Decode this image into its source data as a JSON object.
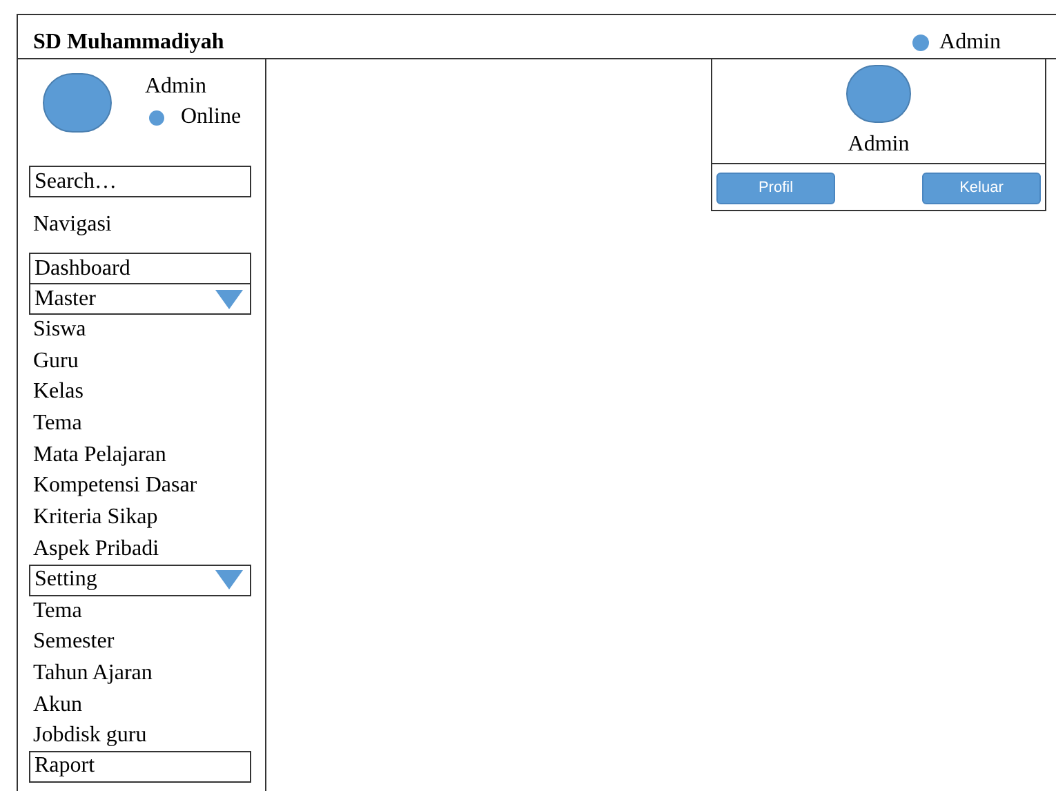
{
  "header": {
    "title": "SD Muhammadiyah",
    "user": "Admin"
  },
  "sidebar": {
    "user": {
      "name": "Admin",
      "status": "Online"
    },
    "search": {
      "placeholder": "Search…"
    },
    "section_label": "Navigasi",
    "items": [
      {
        "kind": "single",
        "label": "Dashboard"
      },
      {
        "kind": "group",
        "label": "Master",
        "expanded": true,
        "children": [
          {
            "label": "Siswa"
          },
          {
            "label": "Guru"
          },
          {
            "label": "Kelas"
          },
          {
            "label": "Tema"
          },
          {
            "label": "Mata Pelajaran"
          },
          {
            "label": "Kompetensi Dasar"
          },
          {
            "label": "Kriteria Sikap"
          },
          {
            "label": "Aspek Pribadi"
          }
        ]
      },
      {
        "kind": "group",
        "label": "Setting",
        "expanded": true,
        "children": [
          {
            "label": "Tema"
          },
          {
            "label": "Semester"
          },
          {
            "label": "Tahun Ajaran"
          },
          {
            "label": "Akun"
          },
          {
            "label": "Jobdisk guru"
          }
        ]
      },
      {
        "kind": "single",
        "label": "Raport"
      }
    ]
  },
  "user_menu": {
    "name": "Admin",
    "buttons": [
      "Profil",
      "Keluar"
    ]
  }
}
